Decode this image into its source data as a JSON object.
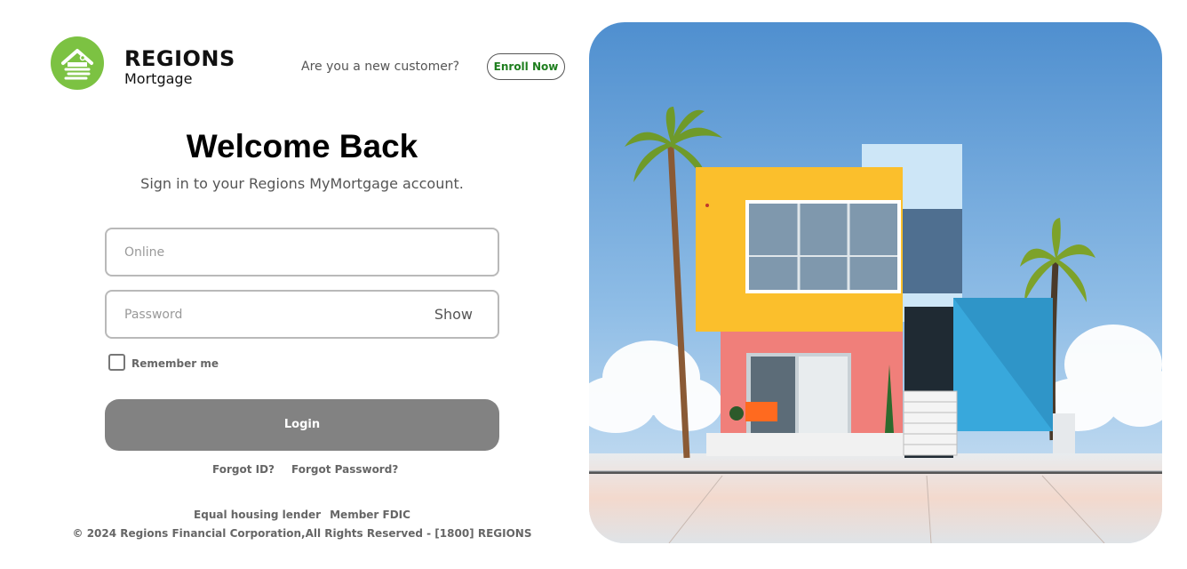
{
  "brand": {
    "name": "REGIONS",
    "sub": "Mortgage",
    "logo_color": "#7cc242",
    "logo_icon": "house-icon"
  },
  "header": {
    "new_customer_text": "Are you a new customer?",
    "enroll_label": "Enroll Now",
    "enroll_color": "#1e7e1e"
  },
  "login": {
    "title": "Welcome Back",
    "subtitle": "Sign in to your Regions MyMortgage account.",
    "online_placeholder": "Online",
    "online_value": "",
    "password_placeholder": "Password",
    "password_value": "",
    "show_label": "Show",
    "remember_label": "Remember me",
    "remember_checked": false,
    "login_label": "Login",
    "login_button_color": "#828282",
    "forgot_id": "Forgot ID?",
    "forgot_password": "Forgot Password?"
  },
  "footer": {
    "equal_housing": "Equal housing lender",
    "member_fdic": "Member FDIC",
    "copyright": "© 2024 Regions Financial Corporation,All Rights Reserved - [1800] REGIONS"
  },
  "hero": {
    "image_subject": "modern-house-illustration"
  }
}
